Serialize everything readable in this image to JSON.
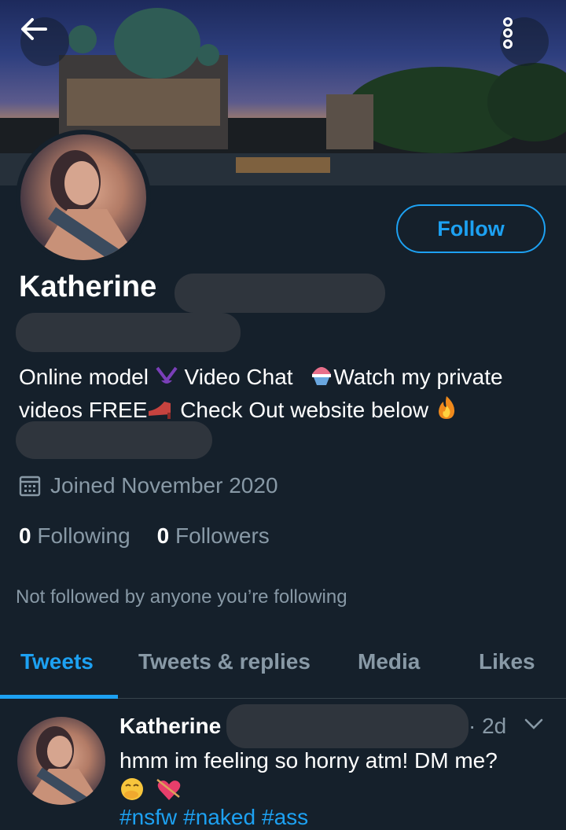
{
  "header": {
    "back_icon": "arrow-left-icon",
    "more_icon": "more-vertical-icon"
  },
  "profile": {
    "follow_label": "Follow",
    "name": "Katherine",
    "bio_line1_a": "Online model",
    "bio_line1_b": "Video Chat",
    "bio_line1_c": "Watch my private",
    "bio_line2_a": "videos FREE",
    "bio_line2_b": "Check Out website below",
    "joined": "Joined November 2020",
    "following_count": "0",
    "following_label": "Following",
    "followers_count": "0",
    "followers_label": "Followers",
    "not_followed": "Not followed by anyone you’re following"
  },
  "tabs": [
    {
      "label": "Tweets",
      "active": true
    },
    {
      "label": "Tweets & replies",
      "active": false
    },
    {
      "label": "Media",
      "active": false
    },
    {
      "label": "Likes",
      "active": false
    }
  ],
  "tweet": {
    "name": "Katherine",
    "time": "· 2d",
    "text": "hmm im feeling so horny atm! DM me?",
    "hashtags": [
      "#nsfw",
      "#naked",
      "#ass"
    ]
  },
  "colors": {
    "background": "#15202b",
    "accent": "#1da1f2",
    "secondary_text": "#8899a6"
  }
}
